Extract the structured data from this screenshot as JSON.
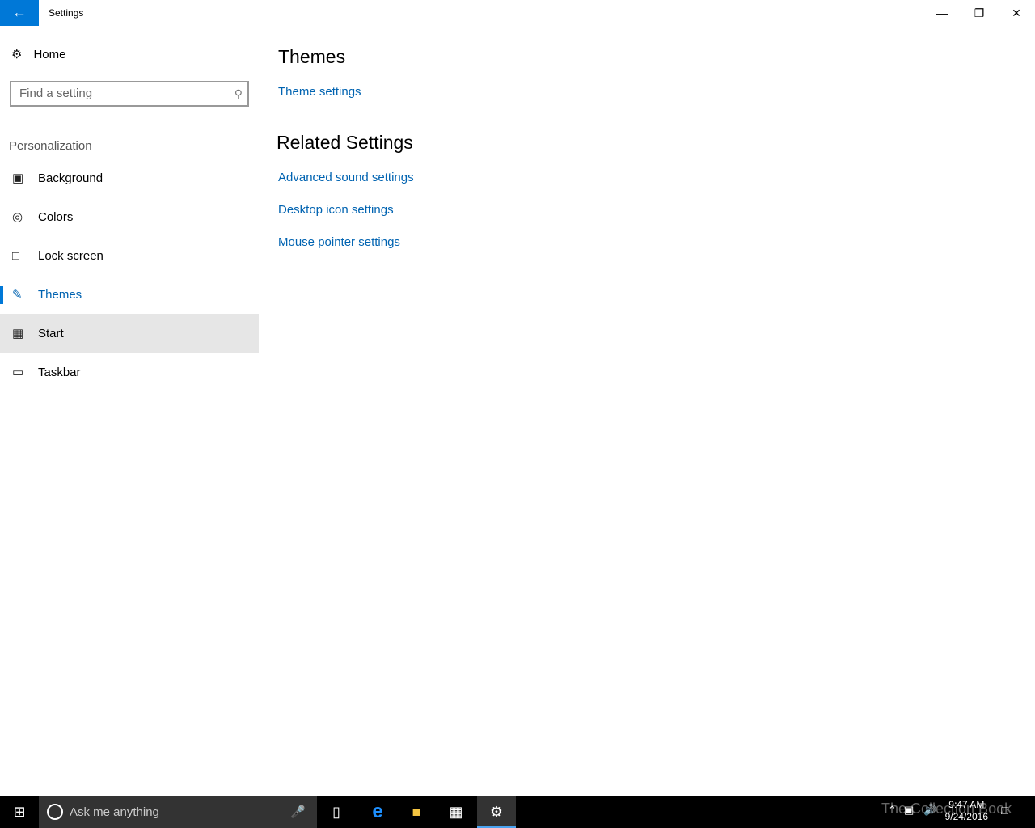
{
  "window": {
    "title": "Settings"
  },
  "sidebar": {
    "home": "Home",
    "search_placeholder": "Find a setting",
    "section": "Personalization",
    "items": [
      {
        "label": "Background",
        "icon": "picture-icon"
      },
      {
        "label": "Colors",
        "icon": "palette-icon"
      },
      {
        "label": "Lock screen",
        "icon": "lock-screen-icon"
      },
      {
        "label": "Themes",
        "icon": "themes-icon",
        "active": true
      },
      {
        "label": "Start",
        "icon": "start-icon",
        "hover": true
      },
      {
        "label": "Taskbar",
        "icon": "taskbar-icon"
      }
    ]
  },
  "main": {
    "themes_heading": "Themes",
    "theme_settings": "Theme settings",
    "related_heading": "Related Settings",
    "related_links": [
      "Advanced sound settings",
      "Desktop icon settings",
      "Mouse pointer settings"
    ]
  },
  "taskbar": {
    "search_placeholder": "Ask me anything",
    "time": "9:47 AM",
    "date": "9/24/2016",
    "watermark": "The Collection Book"
  },
  "colors": {
    "accent": "#0078d7",
    "link": "#0063b1"
  }
}
